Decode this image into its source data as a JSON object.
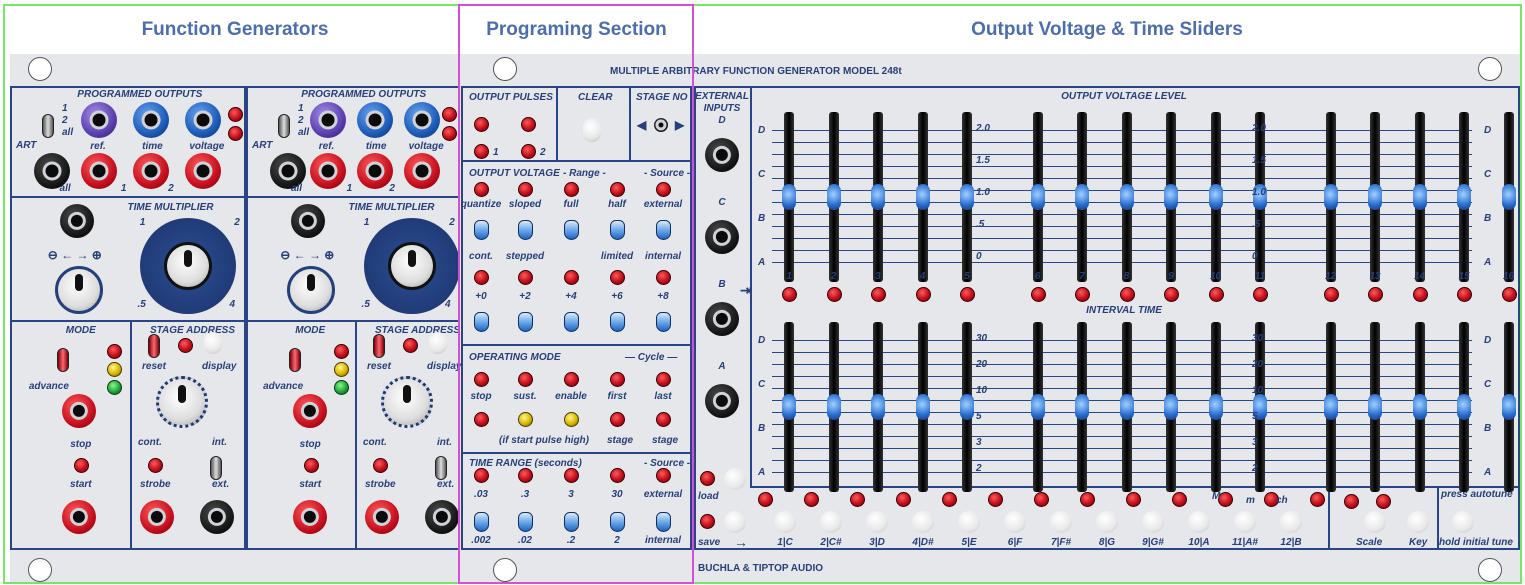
{
  "headers": {
    "function_generators": "Function Generators",
    "programming_section": "Programing Section",
    "output_sliders": "Output Voltage & Time Sliders"
  },
  "panel": {
    "model_title": "MULTIPLE ARBITRARY FUNCTION GENERATOR MODEL 248t",
    "brand": "BUCHLA & TIPTOP AUDIO"
  },
  "func_gen": {
    "programmed_outputs": "PROGRAMMED  OUTPUTS",
    "sel_1": "1",
    "sel_2": "2",
    "sel_all": "all",
    "start_label": "ART",
    "ref": "ref.",
    "time": "time",
    "voltage": "voltage",
    "out_all": "all",
    "out_1": "1",
    "out_2": "2",
    "time_multiplier": "TIME MULTIPLIER",
    "tm_1": "1",
    "tm_2": "2",
    "tm_5": ".5",
    "tm_4": "4",
    "mode": "MODE",
    "advance": "advance",
    "stop": "stop",
    "start": "start",
    "stage_address": "STAGE ADDRESS",
    "reset": "reset",
    "display": "display",
    "cont": "cont.",
    "int": "int.",
    "strobe": "strobe",
    "ext": "ext."
  },
  "prog": {
    "output_pulses": "OUTPUT  PULSES",
    "clear": "CLEAR",
    "stage_no": "STAGE NO",
    "pulse_1": "1",
    "pulse_2": "2",
    "output_voltage": "OUTPUT VOLTAGE",
    "range": "- Range -",
    "source": "- Source -",
    "row1": [
      "quantize",
      "sloped",
      "full",
      "half",
      "external"
    ],
    "row2": [
      "cont.",
      "stepped",
      "",
      "limited",
      "internal"
    ],
    "offsets": [
      "+0",
      "+2",
      "+4",
      "+6",
      "+8"
    ],
    "operating_mode": "OPERATING MODE",
    "cycle": "— Cycle —",
    "op_row": [
      "stop",
      "sust.",
      "enable",
      "first",
      "last"
    ],
    "op_note": "(if start pulse high)",
    "op_stage1": "stage",
    "op_stage2": "stage",
    "time_range": "TIME RANGE (seconds)",
    "tr_source": "- Source -",
    "tr_row1": [
      ".03",
      ".3",
      "3",
      "30",
      "external"
    ],
    "tr_row2": [
      ".002",
      ".02",
      ".2",
      "2",
      "internal"
    ]
  },
  "sliders": {
    "external_inputs": "EXTERNAL INPUTS",
    "inputs": [
      "D",
      "C",
      "B",
      "A"
    ],
    "output_voltage_level": "OUTPUT VOLTAGE LEVEL",
    "interval_time": "INTERVAL TIME",
    "ov_scale": [
      "2.0",
      "1.5",
      "1.0",
      ".5",
      "0"
    ],
    "it_scale": [
      "30",
      "20",
      "10",
      "5",
      "3",
      "2"
    ],
    "letters": [
      "D",
      "C",
      "B",
      "A"
    ],
    "stage_numbers": [
      "1",
      "2",
      "3",
      "4",
      "5",
      "6",
      "7",
      "8",
      "9",
      "10",
      "11",
      "12",
      "13",
      "14",
      "15",
      "16"
    ],
    "load": "load",
    "save": "save",
    "notes": [
      "1|C",
      "2|C#",
      "3|D",
      "4|D#",
      "5|E",
      "6|F",
      "7|F#",
      "8|G",
      "9|G#",
      "10|A",
      "11|A#",
      "12|B"
    ],
    "M": "M",
    "m": "m",
    "ch": "ch",
    "scale": "Scale",
    "key": "Key",
    "press_autotune": "press autotune",
    "hold_initial_tune": "hold initial tune"
  },
  "colors": {
    "header_text": "#4d6ea7",
    "frame_green": "#7ae36a",
    "frame_magenta": "#d44fd6",
    "panel_blue": "#2a4585"
  }
}
